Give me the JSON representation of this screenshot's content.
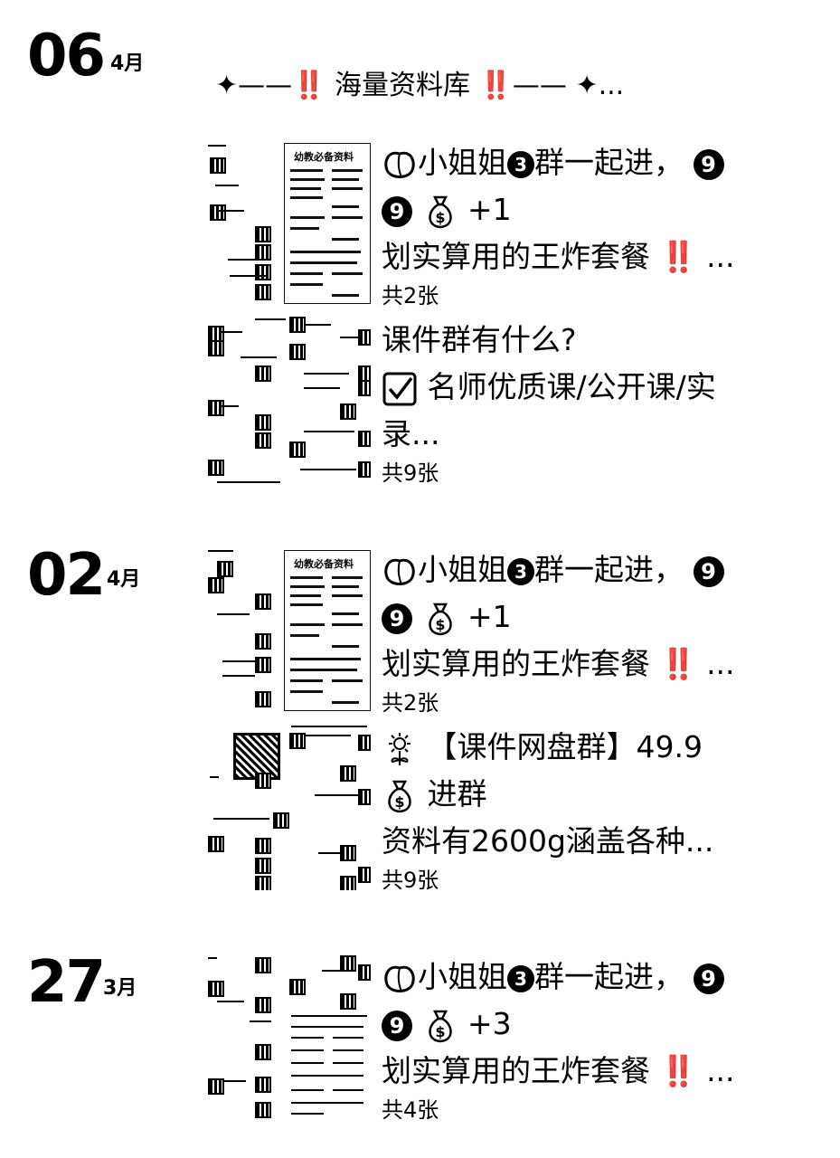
{
  "groups": [
    {
      "day": "06",
      "month": "4月",
      "text_post": "✦——‼️ 海量资料库 ‼️—— ✦...",
      "posts": [
        {
          "line1": "小姐姐",
          "line1b": "群一起进，",
          "line2b": "+1",
          "line3": "划实算用的王炸套餐 ‼️ ...",
          "count": "共2张",
          "thumb_title": "幼教必备资料"
        },
        {
          "line1": "课件群有什么?",
          "line2": "名师优质课/公开课/实",
          "line3": "录...",
          "count": "共9张"
        }
      ]
    },
    {
      "day": "02",
      "month": "4月",
      "posts": [
        {
          "line1": "小姐姐",
          "line1b": "群一起进，",
          "line2b": "+1",
          "line3": "划实算用的王炸套餐 ‼️ ...",
          "count": "共2张",
          "thumb_title": "幼教必备资料"
        },
        {
          "line1": "【课件网盘群】49.9",
          "line2": "进群",
          "line3": "资料有2600g涵盖各种...",
          "count": "共9张"
        }
      ]
    },
    {
      "day": "27",
      "month": "3月",
      "posts": [
        {
          "line1": "小姐姐",
          "line1b": "群一起进，",
          "line2b": "+3",
          "line3": "划实算用的王炸套餐 ‼️ ...",
          "count": "共4张"
        }
      ]
    }
  ],
  "icons": {
    "peach": "peach-icon",
    "circled3": "3",
    "circled9": "9",
    "moneybag": "money-bag-icon",
    "check": "checkbox-icon",
    "sunflower": "flower-icon"
  },
  "colors": {
    "text": "#000000",
    "background": "#ffffff"
  }
}
